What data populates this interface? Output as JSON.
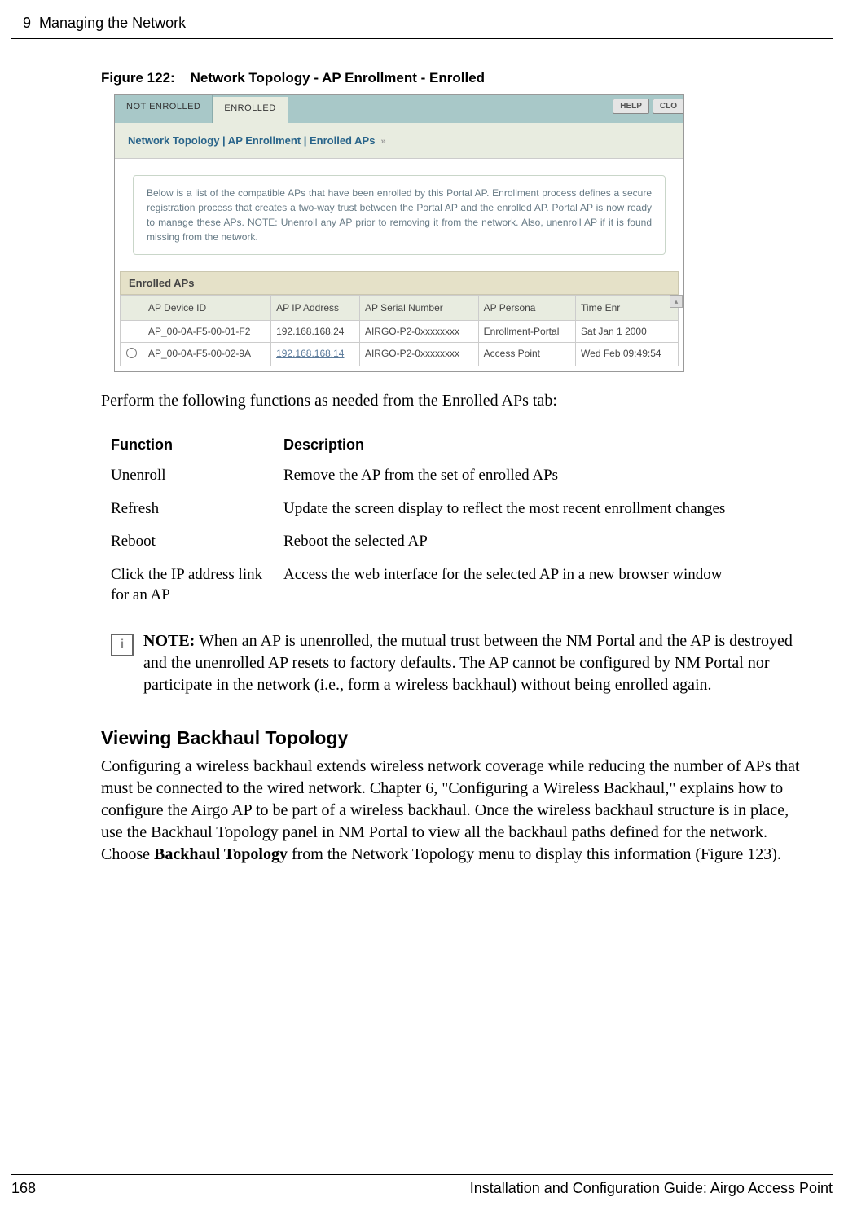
{
  "header": {
    "chapter": "9",
    "title": "Managing the Network"
  },
  "figure": {
    "label": "Figure 122:",
    "caption": "Network Topology - AP Enrollment - Enrolled"
  },
  "screenshot": {
    "tabs": {
      "not_enrolled": "NOT ENROLLED",
      "enrolled": "ENROLLED"
    },
    "top_buttons": {
      "help": "HELP",
      "close": "CLO"
    },
    "breadcrumb": "Network Topology | AP Enrollment | Enrolled APs",
    "description": "Below is a list of the compatible APs that have been enrolled by this Portal AP. Enrollment process defines a secure registration process that creates a two-way trust between the Portal AP and the enrolled AP. Portal AP is now ready to manage these APs. NOTE: Unenroll any AP prior to removing it from the network. Also, unenroll AP if it is found missing from the network.",
    "section_title": "Enrolled APs",
    "columns": {
      "device_id": "AP Device ID",
      "ip": "AP IP Address",
      "serial": "AP Serial Number",
      "persona": "AP Persona",
      "time": "Time Enr"
    },
    "rows": [
      {
        "device_id": "AP_00-0A-F5-00-01-F2",
        "ip": "192.168.168.24",
        "serial": "AIRGO-P2-0xxxxxxxx",
        "persona": "Enrollment-Portal",
        "time": "Sat Jan 1 2000",
        "has_radio": false
      },
      {
        "device_id": "AP_00-0A-F5-00-02-9A",
        "ip": "192.168.168.14",
        "serial": "AIRGO-P2-0xxxxxxxx",
        "persona": "Access Point",
        "time": "Wed Feb 09:49:54",
        "has_radio": true
      }
    ]
  },
  "intro_text": "Perform the following functions as needed from the Enrolled APs tab:",
  "functions_table": {
    "header_function": "Function",
    "header_description": "Description",
    "rows": [
      {
        "func": "Unenroll",
        "desc": "Remove the AP from the set of enrolled APs"
      },
      {
        "func": "Refresh",
        "desc": "Update the screen display to reflect the most recent enrollment changes"
      },
      {
        "func": "Reboot",
        "desc": "Reboot the selected AP"
      },
      {
        "func": "Click the IP address link for an AP",
        "desc": "Access the web interface for the selected AP in a new browser window"
      }
    ]
  },
  "note": {
    "label": "NOTE:",
    "text": " When an AP is unenrolled, the mutual trust between the NM Portal and the AP is destroyed and the unenrolled AP resets to factory defaults. The AP cannot be configured by NM Portal nor participate in the network (i.e., form a wireless backhaul) without being enrolled again."
  },
  "section2": {
    "heading": "Viewing Backhaul Topology",
    "body_pre": "Configuring a wireless backhaul extends wireless network coverage while reducing the number of APs that must be connected to the wired network. Chapter 6, \"Configuring a Wireless Backhaul,\" explains how to configure the Airgo AP to be part of a wireless backhaul. Once the wireless backhaul structure is in place, use the Backhaul Topology panel in NM Portal to view all the backhaul paths defined for the network. Choose ",
    "body_bold": "Backhaul Topology",
    "body_post": " from the Network Topology menu to display this information (Figure 123)."
  },
  "footer": {
    "page": "168",
    "doc": "Installation and Configuration Guide: Airgo Access Point"
  }
}
